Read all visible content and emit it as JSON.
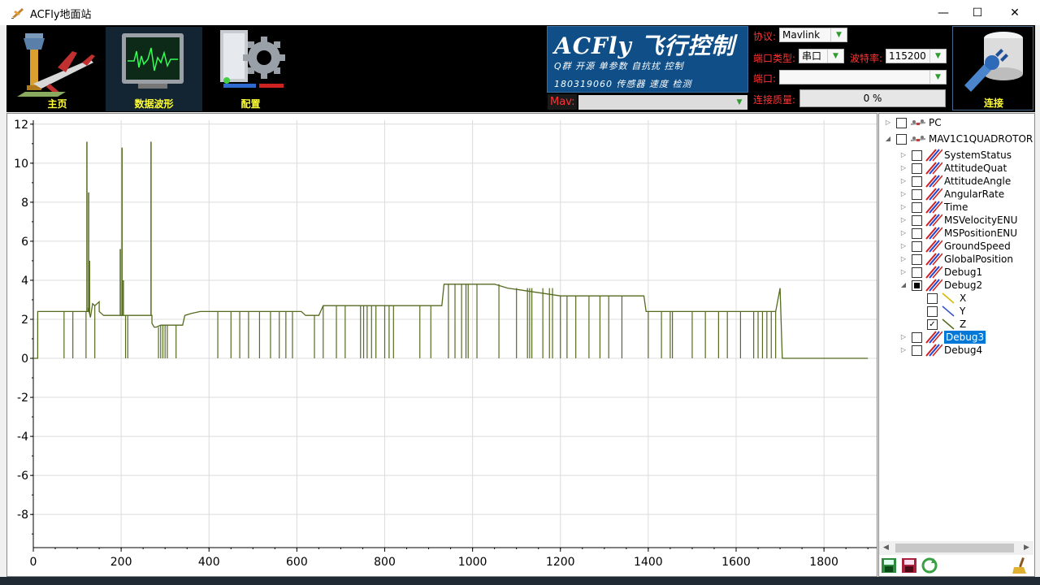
{
  "window": {
    "title": "ACFly地面站",
    "minimize": "—",
    "maximize": "☐",
    "close": "✕"
  },
  "nav": [
    {
      "label": "主页",
      "icon": "airport-tower-icon"
    },
    {
      "label": "数据波形",
      "icon": "oscilloscope-icon"
    },
    {
      "label": "配置",
      "icon": "settings-gear-icon"
    }
  ],
  "logo": {
    "line1": "ACFly 飞行控制",
    "line2": "Q群  开源 单参数 自抗扰 控制",
    "line3": "180319060  传感器 速度 检测"
  },
  "connection": {
    "protocol_label": "协议:",
    "protocol_value": "Mavlink",
    "port_type_label": "端口类型:",
    "port_type_value": "串口",
    "baud_label": "波特率:",
    "baud_value": "115200",
    "port_label": "端口:",
    "port_value": "",
    "quality_label": "连接质量:",
    "quality_value": "0  %",
    "mav_label": "Mav:",
    "mav_value": "",
    "connect_label": "连接"
  },
  "chart_data": {
    "type": "line",
    "title": "",
    "xlabel": "",
    "ylabel": "",
    "xlim": [
      0,
      1920
    ],
    "ylim": [
      -9.7,
      12.2
    ],
    "x_ticks": [
      0,
      200,
      400,
      600,
      800,
      1000,
      1200,
      1400,
      1600,
      1800
    ],
    "y_ticks": [
      12,
      10,
      8,
      6,
      4,
      2,
      0,
      -2,
      -4,
      -6,
      -8
    ],
    "grid": true,
    "series": [
      {
        "name": "Z",
        "color": "#556b1f",
        "x": [
          0,
          10,
          10,
          125,
          125,
          128,
          130,
          135,
          140,
          150,
          150,
          155,
          160,
          170,
          185,
          270,
          270,
          275,
          280,
          290,
          300,
          340,
          345,
          360,
          380,
          500,
          610,
          620,
          650,
          660,
          800,
          930,
          935,
          1000,
          1050,
          1080,
          1200,
          1300,
          1390,
          1395,
          1500,
          1600,
          1690,
          1700,
          1705,
          1900
        ],
        "y": [
          0,
          0,
          2.4,
          2.4,
          2.6,
          2.3,
          2.1,
          2.8,
          2.7,
          2.9,
          2.4,
          2.3,
          2.2,
          2.2,
          2.2,
          2.2,
          1.8,
          1.6,
          1.6,
          1.7,
          1.7,
          1.7,
          2.2,
          2.3,
          2.4,
          2.4,
          2.4,
          2.2,
          2.2,
          2.7,
          2.7,
          2.7,
          3.8,
          3.8,
          3.8,
          3.6,
          3.2,
          3.2,
          3.2,
          2.4,
          2.4,
          2.4,
          2.4,
          3.6,
          0,
          0
        ],
        "spikes": [
          {
            "x": 122,
            "y": 11.1
          },
          {
            "x": 126,
            "y": 8.5
          },
          {
            "x": 128,
            "y": 5.0
          },
          {
            "x": 198,
            "y": 5.6
          },
          {
            "x": 202,
            "y": 10.8
          },
          {
            "x": 205,
            "y": 4.0
          },
          {
            "x": 268,
            "y": 11.1
          }
        ],
        "dropouts": [
          70,
          90,
          120,
          140,
          210,
          215,
          285,
          290,
          295,
          300,
          305,
          325,
          420,
          450,
          470,
          490,
          515,
          540,
          560,
          575,
          590,
          640,
          660,
          690,
          710,
          745,
          752,
          760,
          770,
          780,
          800,
          810,
          820,
          880,
          905,
          945,
          960,
          975,
          985,
          990,
          1010,
          1060,
          1100,
          1125,
          1130,
          1135,
          1160,
          1175,
          1182,
          1200,
          1215,
          1235,
          1265,
          1290,
          1310,
          1340,
          1400,
          1430,
          1450,
          1455,
          1500,
          1530,
          1560,
          1580,
          1610,
          1640,
          1650,
          1660,
          1670,
          1680,
          1690
        ]
      }
    ]
  },
  "tree": {
    "items": [
      {
        "label": "PC",
        "level": 0,
        "expander": "collapsed",
        "checked": "none",
        "icon": "drone-icon"
      },
      {
        "label": "MAV1C1QUADROTOR",
        "level": 0,
        "expander": "expanded",
        "checked": "none",
        "icon": "drone-icon"
      },
      {
        "label": "SystemStatus",
        "level": 1,
        "expander": "collapsed",
        "checked": "none",
        "icon": "series-lines-icon"
      },
      {
        "label": "AttitudeQuat",
        "level": 1,
        "expander": "collapsed",
        "checked": "none",
        "icon": "series-lines-icon"
      },
      {
        "label": "AttitudeAngle",
        "level": 1,
        "expander": "collapsed",
        "checked": "none",
        "icon": "series-lines-icon"
      },
      {
        "label": "AngularRate",
        "level": 1,
        "expander": "collapsed",
        "checked": "none",
        "icon": "series-lines-icon"
      },
      {
        "label": "Time",
        "level": 1,
        "expander": "collapsed",
        "checked": "none",
        "icon": "series-lines-icon"
      },
      {
        "label": "MSVelocityENU",
        "level": 1,
        "expander": "collapsed",
        "checked": "none",
        "icon": "series-lines-icon"
      },
      {
        "label": "MSPositionENU",
        "level": 1,
        "expander": "collapsed",
        "checked": "none",
        "icon": "series-lines-icon"
      },
      {
        "label": "GroundSpeed",
        "level": 1,
        "expander": "collapsed",
        "checked": "none",
        "icon": "series-lines-icon"
      },
      {
        "label": "GlobalPosition",
        "level": 1,
        "expander": "collapsed",
        "checked": "none",
        "icon": "series-lines-icon"
      },
      {
        "label": "Debug1",
        "level": 1,
        "expander": "collapsed",
        "checked": "none",
        "icon": "series-lines-icon"
      },
      {
        "label": "Debug2",
        "level": 1,
        "expander": "expanded",
        "checked": "partial",
        "icon": "series-lines-icon"
      },
      {
        "label": "X",
        "level": 2,
        "expander": "none",
        "checked": "none",
        "icon": "line-yellow-icon"
      },
      {
        "label": "Y",
        "level": 2,
        "expander": "none",
        "checked": "none",
        "icon": "line-blue-icon"
      },
      {
        "label": "Z",
        "level": 2,
        "expander": "none",
        "checked": "checked",
        "icon": "line-green-icon"
      },
      {
        "label": "Debug3",
        "level": 1,
        "expander": "collapsed",
        "checked": "none",
        "icon": "series-lines-icon",
        "selected": true
      },
      {
        "label": "Debug4",
        "level": 1,
        "expander": "collapsed",
        "checked": "none",
        "icon": "series-lines-icon"
      }
    ]
  },
  "bottom_icons": [
    "load-file-icon",
    "save-file-icon",
    "refresh-icon",
    "clear-broom-icon"
  ]
}
